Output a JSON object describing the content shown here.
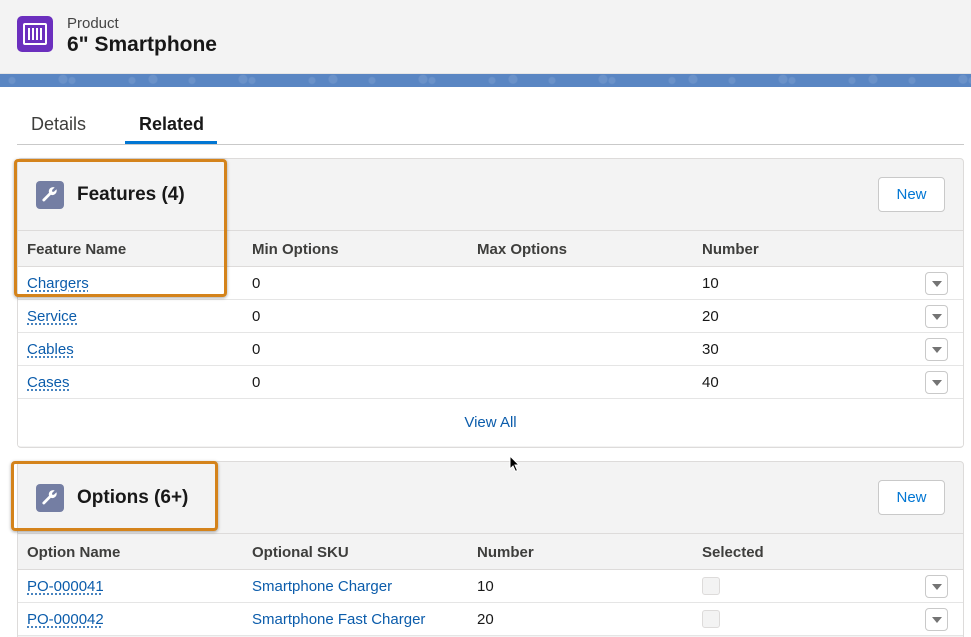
{
  "header": {
    "object_label": "Product",
    "record_title": "6\" Smartphone",
    "icon": "product-barcode-icon"
  },
  "tabs": [
    {
      "label": "Details",
      "active": false
    },
    {
      "label": "Related",
      "active": true
    }
  ],
  "features": {
    "title": "Features (4)",
    "icon": "wrench-icon",
    "new_label": "New",
    "columns": [
      "Feature Name",
      "Min Options",
      "Max Options",
      "Number"
    ],
    "rows": [
      {
        "name": "Chargers",
        "min": "0",
        "max": "",
        "number": "10"
      },
      {
        "name": "Service",
        "min": "0",
        "max": "",
        "number": "20"
      },
      {
        "name": "Cables",
        "min": "0",
        "max": "",
        "number": "30"
      },
      {
        "name": "Cases",
        "min": "0",
        "max": "",
        "number": "40"
      }
    ],
    "view_all": "View All"
  },
  "options": {
    "title": "Options (6+)",
    "icon": "wrench-icon",
    "new_label": "New",
    "columns": [
      "Option Name",
      "Optional SKU",
      "Number",
      "Selected"
    ],
    "rows": [
      {
        "name": "PO-000041",
        "sku": "Smartphone Charger",
        "number": "10",
        "selected": false
      },
      {
        "name": "PO-000042",
        "sku": "Smartphone Fast Charger",
        "number": "20",
        "selected": false
      }
    ]
  },
  "colors": {
    "accent": "#0176d3",
    "link": "#0b5cab",
    "product_icon_bg": "#6b2fbe",
    "card_icon_bg": "#747ea3",
    "callout": "#d4831b"
  }
}
